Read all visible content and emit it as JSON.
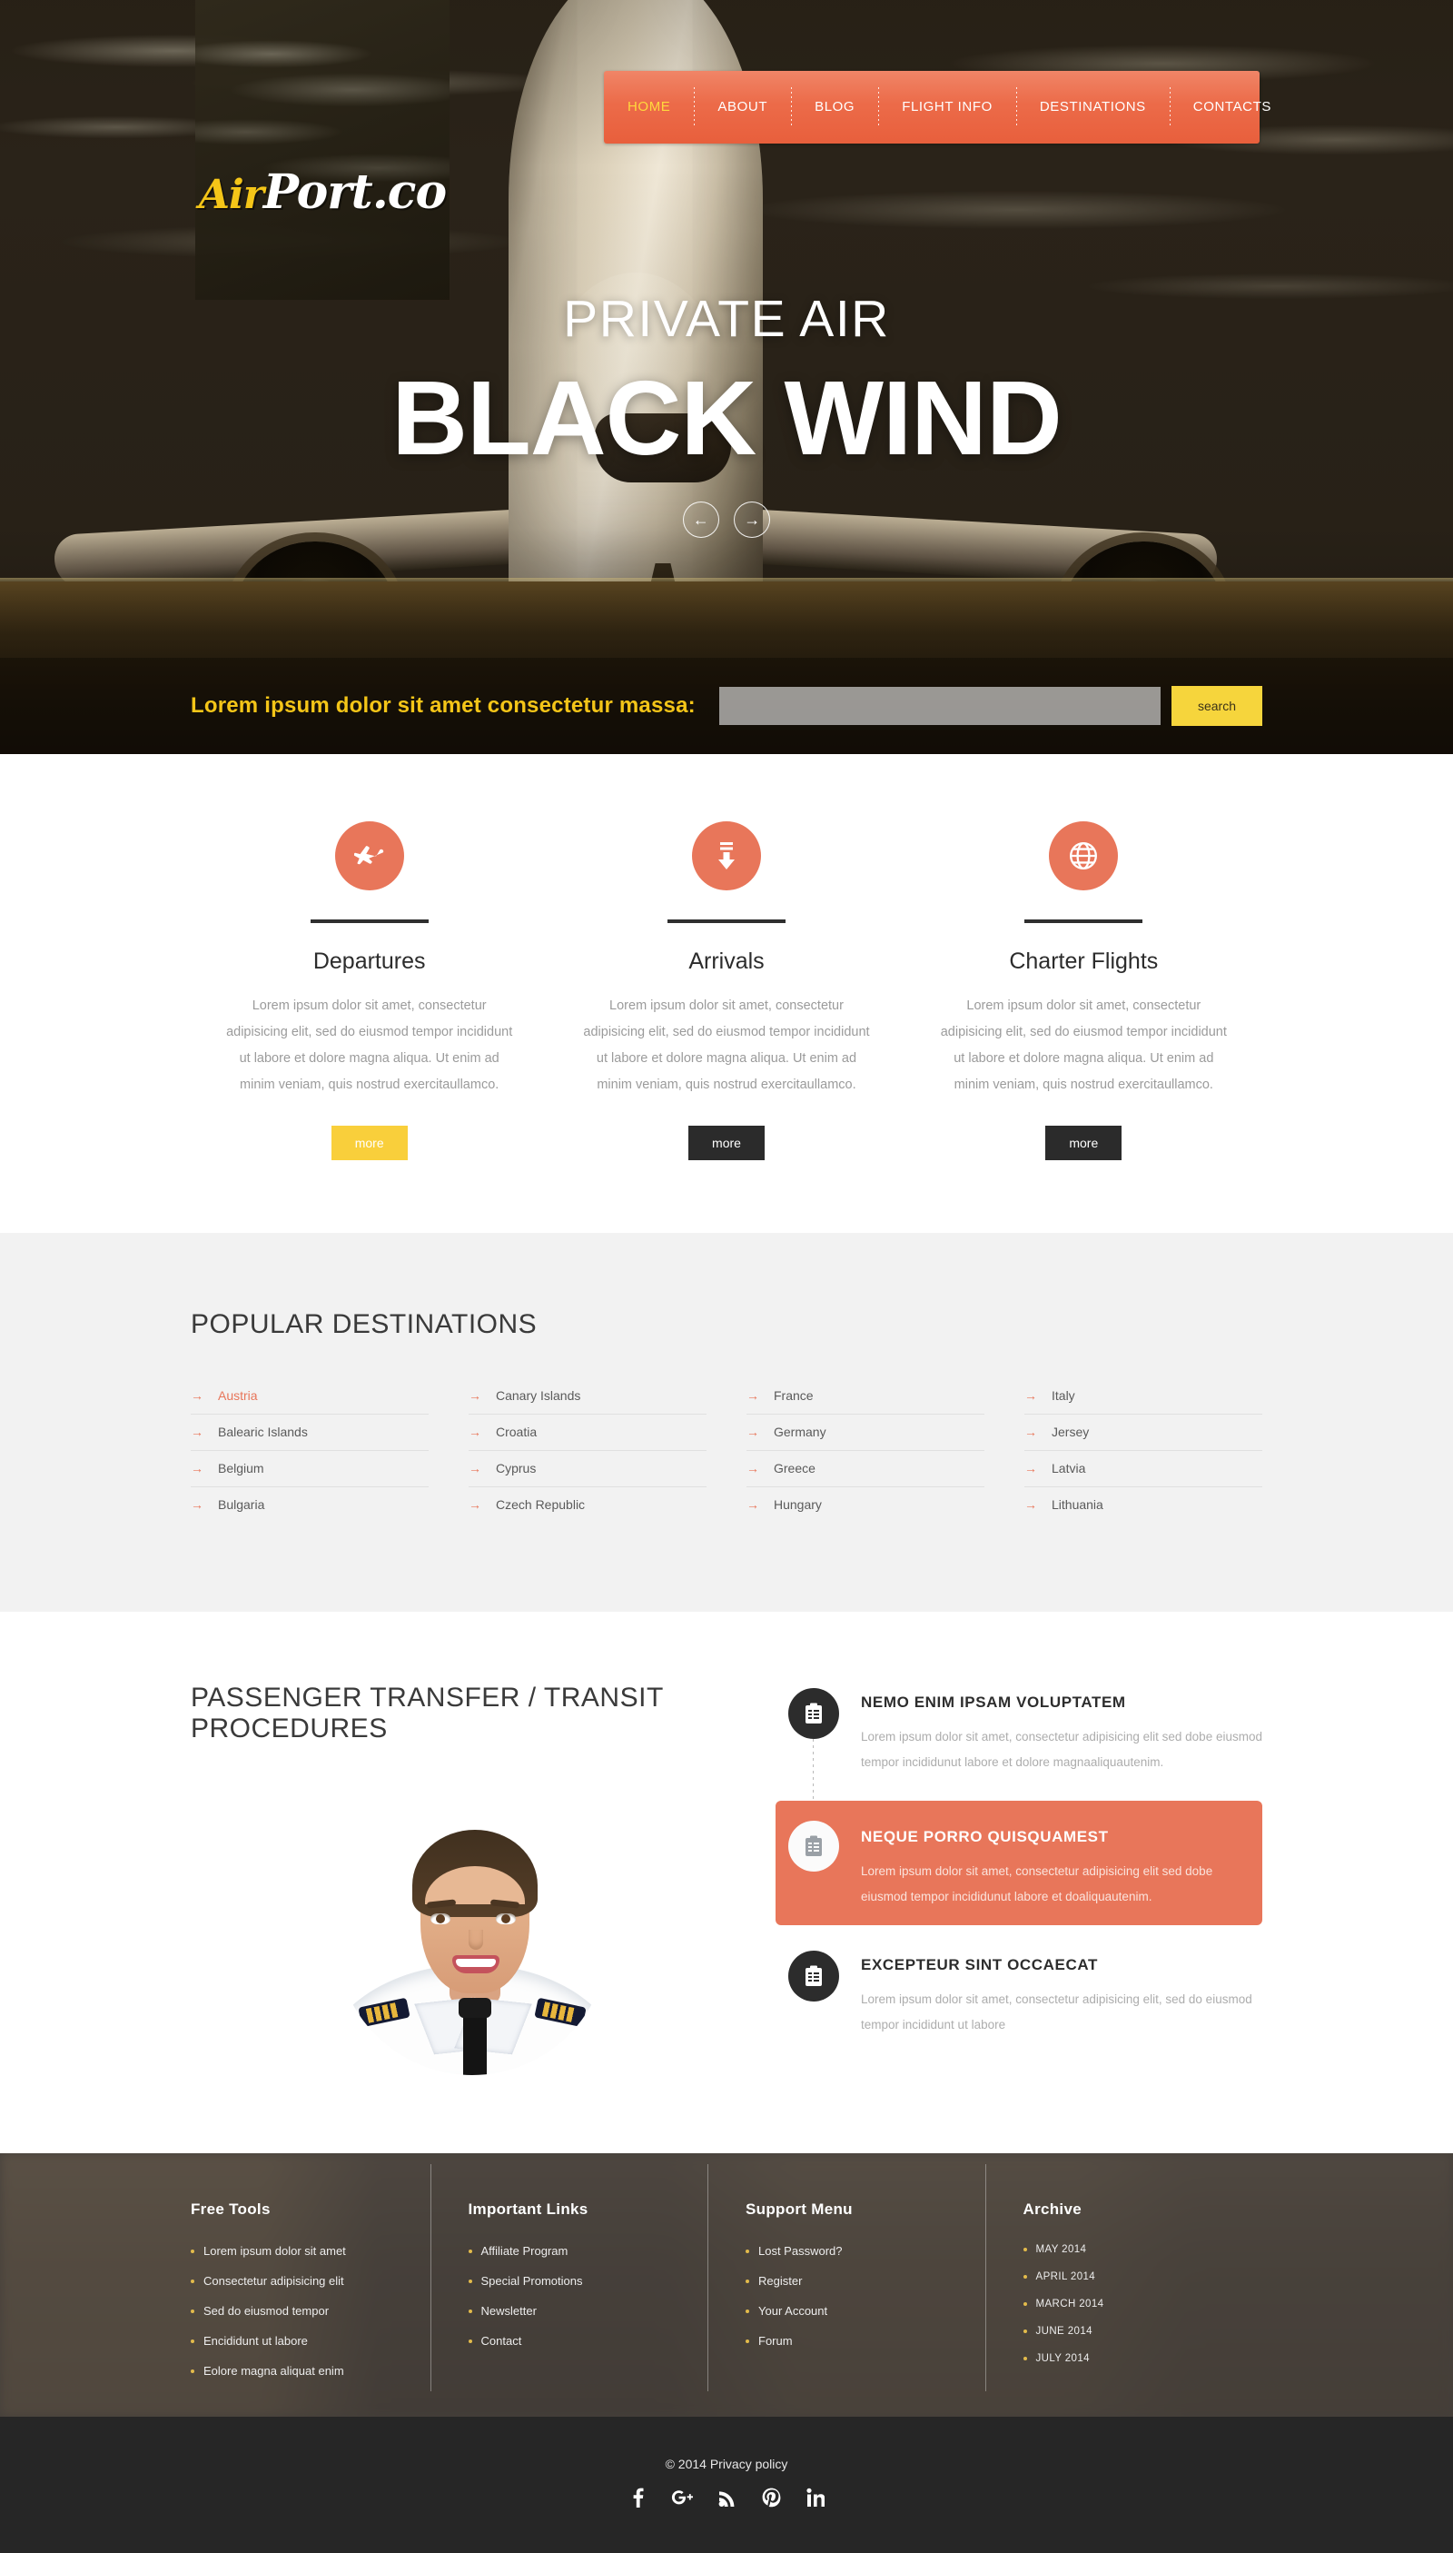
{
  "brand": {
    "name_part1": "Air",
    "name_part2": "Port.co"
  },
  "nav": {
    "items": [
      {
        "label": "HOME",
        "active": true
      },
      {
        "label": "ABOUT",
        "active": false
      },
      {
        "label": "BLOG",
        "active": false
      },
      {
        "label": "FLIGHT INFO",
        "active": false
      },
      {
        "label": "DESTINATIONS",
        "active": false
      },
      {
        "label": "CONTACTS",
        "active": false
      }
    ]
  },
  "hero": {
    "subtitle": "PRIVATE AIR",
    "title": "BLACK WIND",
    "prev_icon": "arrow-left-icon",
    "next_icon": "arrow-right-icon"
  },
  "search": {
    "label": "Lorem ipsum dolor sit amet consectetur massa:",
    "value": "",
    "placeholder": "",
    "button": "search"
  },
  "services": [
    {
      "icon": "airplane-icon",
      "title": "Departures",
      "text": "Lorem ipsum dolor sit amet, consectetur adipisicing elit, sed do eiusmod tempor incididunt ut labore et dolore magna aliqua. Ut enim ad minim veniam, quis nostrud exercitaullamco.",
      "button": "more",
      "highlighted": true
    },
    {
      "icon": "arrow-down-icon",
      "title": "Arrivals",
      "text": "Lorem ipsum dolor sit amet, consectetur adipisicing elit, sed do eiusmod tempor incididunt ut labore et dolore magna aliqua. Ut enim ad minim veniam, quis nostrud exercitaullamco.",
      "button": "more",
      "highlighted": false
    },
    {
      "icon": "globe-icon",
      "title": "Charter Flights",
      "text": "Lorem ipsum dolor sit amet, consectetur adipisicing elit, sed do eiusmod tempor incididunt ut labore et dolore magna aliqua. Ut enim ad minim veniam, quis nostrud exercitaullamco.",
      "button": "more",
      "highlighted": false
    }
  ],
  "destinations": {
    "title": "POPULAR DESTINATIONS",
    "arrow_icon": "arrow-right-small-icon",
    "columns": [
      [
        {
          "name": "Austria",
          "active": true
        },
        {
          "name": "Balearic Islands",
          "active": false
        },
        {
          "name": "Belgium",
          "active": false
        },
        {
          "name": "Bulgaria",
          "active": false
        }
      ],
      [
        {
          "name": "Canary Islands",
          "active": false
        },
        {
          "name": "Croatia",
          "active": false
        },
        {
          "name": "Cyprus",
          "active": false
        },
        {
          "name": "Czech Republic",
          "active": false
        }
      ],
      [
        {
          "name": "France",
          "active": false
        },
        {
          "name": "Germany",
          "active": false
        },
        {
          "name": "Greece",
          "active": false
        },
        {
          "name": "Hungary",
          "active": false
        }
      ],
      [
        {
          "name": "Italy",
          "active": false
        },
        {
          "name": "Jersey",
          "active": false
        },
        {
          "name": "Latvia",
          "active": false
        },
        {
          "name": "Lithuania",
          "active": false
        }
      ]
    ]
  },
  "transfer": {
    "title": "PASSENGER TRANSFER / TRANSIT PROCEDURES",
    "image_alt": "pilot-portrait",
    "steps": [
      {
        "icon": "clipboard-icon",
        "title": "NEMO ENIM IPSAM VOLUPTATEM",
        "text": "Lorem ipsum dolor sit amet, consectetur adipisicing elit sed dobe eiusmod tempor incididunut labore et dolore magnaaliquautenim.",
        "active": false
      },
      {
        "icon": "clipboard-icon",
        "title": "NEQUE PORRO QUISQUAMEST",
        "text": "Lorem ipsum dolor sit amet, consectetur adipisicing elit sed dobe eiusmod tempor incididunut labore et doaliquautenim.",
        "active": true
      },
      {
        "icon": "clipboard-icon",
        "title": "EXCEPTEUR SINT OCCAECAT",
        "text": "Lorem ipsum dolor sit amet, consectetur adipisicing elit, sed do eiusmod tempor incididunt ut labore",
        "active": false
      }
    ]
  },
  "footer": {
    "columns": [
      {
        "title": "Free Tools",
        "items": [
          "Lorem ipsum dolor sit amet",
          "Consectetur adipisicing elit",
          "Sed do eiusmod tempor",
          "Encididunt ut labore",
          "Eolore magna aliquat enim"
        ]
      },
      {
        "title": "Important Links",
        "items": [
          "Affiliate Program",
          "Special Promotions",
          "Newsletter",
          "Contact"
        ]
      },
      {
        "title": "Support Menu",
        "items": [
          "Lost Password?",
          "Register",
          "Your Account",
          "Forum"
        ]
      },
      {
        "title": "Archive",
        "items": [
          "MAY 2014",
          "APRIL 2014",
          "MARCH 2014",
          "JUNE 2014",
          "JULY 2014"
        ]
      }
    ]
  },
  "copyright": {
    "text": "© 2014 Privacy policy",
    "socials": [
      {
        "icon": "facebook-icon",
        "label": "f"
      },
      {
        "icon": "google-plus-icon",
        "label": "g+"
      },
      {
        "icon": "rss-icon",
        "label": "rss"
      },
      {
        "icon": "pinterest-icon",
        "label": "p"
      },
      {
        "icon": "linkedin-icon",
        "label": "in"
      }
    ]
  },
  "colors": {
    "accent_orange": "#e8765a",
    "accent_yellow": "#f4c518",
    "search_button": "#f6d53c",
    "dark": "#2b2b2b"
  }
}
